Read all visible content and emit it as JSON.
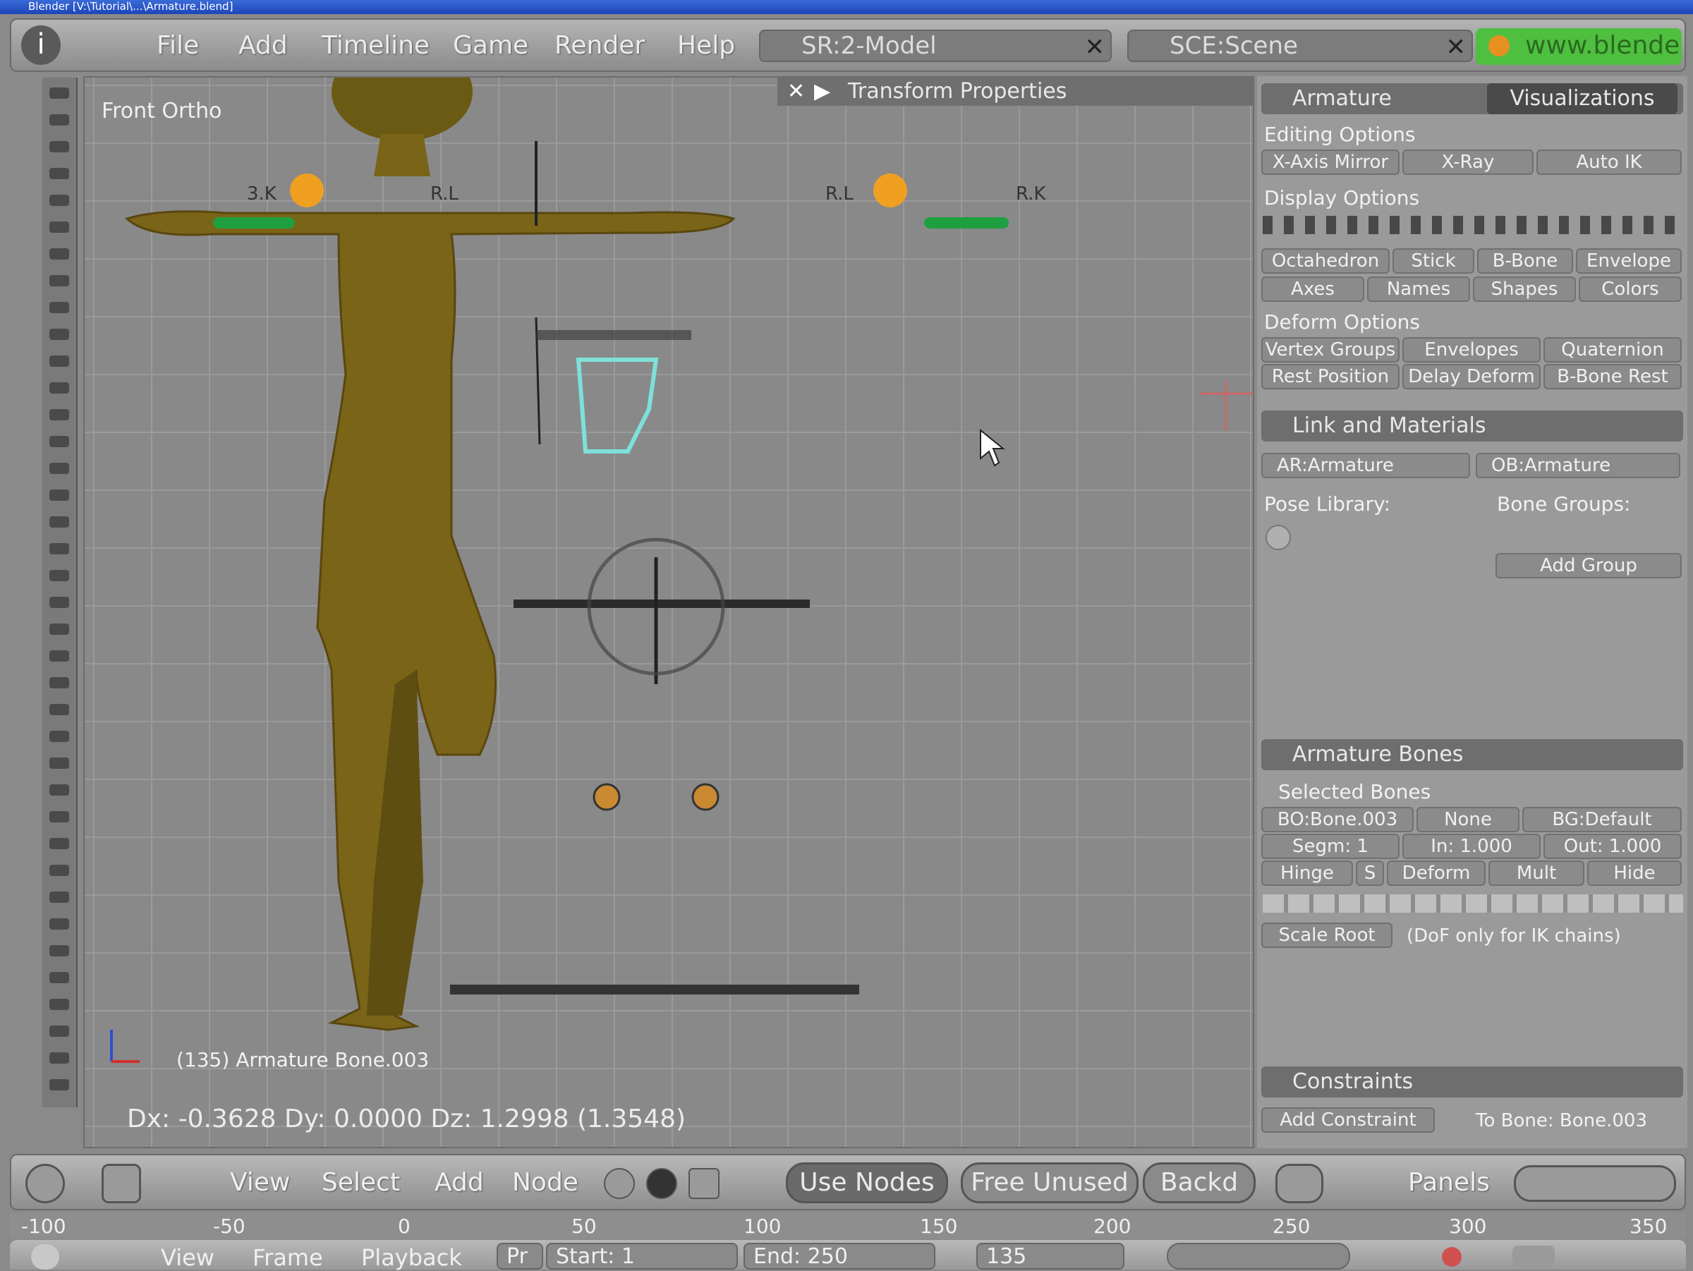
{
  "window": {
    "title": "Blender  [V:\\Tutorial\\...\\Armature.blend]"
  },
  "menubar": {
    "items": [
      "File",
      "Add",
      "Timeline",
      "Game",
      "Render",
      "Help"
    ],
    "screen_field": "SR:2-Model",
    "scene_field": "SCE:Scene",
    "website_button": "www.blender"
  },
  "viewport": {
    "view_label": "Front Ortho",
    "transform_panel_title": "Transform Properties",
    "object_label": "(135) Armature Bone.003",
    "coordinates": "Dx: -0.3628   Dy: 0.0000   Dz: 1.2998 (1.3548)",
    "bone_labels": [
      "3.K",
      "R.L",
      "R.L",
      "R.K"
    ]
  },
  "properties": {
    "tab_armature": "Armature",
    "tab_visualizations": "Visualizations",
    "editing_options": "Editing Options",
    "editing_buttons": [
      "X-Axis Mirror",
      "X-Ray",
      "Auto IK"
    ],
    "display_options": "Display Options",
    "display_buttons_row1": [
      "Octahedron",
      "Stick",
      "B-Bone",
      "Envelope"
    ],
    "display_buttons_row2": [
      "Axes",
      "Names",
      "Shapes",
      "Colors"
    ],
    "deform_options": "Deform Options",
    "deform_buttons_row1": [
      "Vertex Groups",
      "Envelopes",
      "Quaternion"
    ],
    "deform_buttons_row2": [
      "Rest Position",
      "Delay Deform",
      "B-Bone Rest"
    ],
    "link_materials": "Link and Materials",
    "ar_field": "AR:Armature",
    "ob_field": "OB:Armature",
    "pose_library": "Pose Library:",
    "bone_groups": "Bone Groups:",
    "add_group": "Add Group",
    "armature_bones": "Armature Bones",
    "selected_bones": "Selected Bones",
    "bo_field": "BO:Bone.003",
    "child_of": "None",
    "bone_group_field": "BG:Default",
    "segm": "Segm: 1",
    "in": "In: 1.000",
    "out": "Out: 1.000",
    "bone_buttons": [
      "Hinge",
      "S",
      "Deform",
      "Mult",
      "Hide"
    ],
    "scale_root": "Scale Root",
    "dof_note": "(DoF only for IK chains)",
    "constraints": "Constraints",
    "add_constraint": "Add Constraint",
    "to_bone": "To Bone: Bone.003"
  },
  "view_header": {
    "items": [
      "View",
      "Select",
      "Add",
      "Node"
    ],
    "use_nodes": "Use Nodes",
    "free_unused": "Free Unused",
    "backdrop": "Backd",
    "panels": "Panels"
  },
  "ruler": {
    "labels": [
      "-100",
      "-50",
      "0",
      "50",
      "100",
      "150",
      "200",
      "250",
      "300",
      "350"
    ]
  },
  "timeline": {
    "items": [
      "View",
      "Frame",
      "Playback"
    ],
    "pr_field": "Pr",
    "start": "Start: 1",
    "end": "End: 250",
    "current": "135"
  },
  "colors": {
    "accent_green": "#4fbf3f",
    "selected_bone": "#7ee0d8",
    "title_blue": "#2a58c8"
  }
}
